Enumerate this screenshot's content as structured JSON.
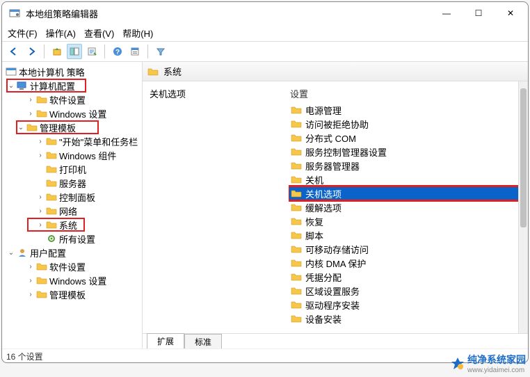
{
  "window": {
    "title": "本地组策略编辑器",
    "controls": {
      "min": "—",
      "max": "☐",
      "close": "✕"
    }
  },
  "menu": {
    "file": "文件(F)",
    "action": "操作(A)",
    "view": "查看(V)",
    "help": "帮助(H)"
  },
  "toolbar_icons": [
    "back",
    "forward",
    "up",
    "list",
    "export",
    "refresh",
    "help",
    "properties",
    "filter"
  ],
  "tree": {
    "root": "本地计算机 策略",
    "computer_config": "计算机配置",
    "software": "软件设置",
    "windows_settings": "Windows 设置",
    "admin_templates": "管理模板",
    "start_menu": "\"开始\"菜单和任务栏",
    "win_components": "Windows 组件",
    "printers": "打印机",
    "servers": "服务器",
    "control_panel": "控制面板",
    "network": "网络",
    "system": "系统",
    "all_settings": "所有设置",
    "user_config": "用户配置",
    "u_software": "软件设置",
    "u_windows": "Windows 设置",
    "u_admin": "管理模板"
  },
  "content": {
    "header_label": "系统",
    "left_title": "关机选项",
    "col_header": "设置",
    "items": [
      "电源管理",
      "访问被拒绝协助",
      "分布式 COM",
      "服务控制管理器设置",
      "服务器管理器",
      "关机",
      "关机选项",
      "缓解选项",
      "恢复",
      "脚本",
      "可移动存储访问",
      "内核 DMA 保护",
      "凭据分配",
      "区域设置服务",
      "驱动程序安装",
      "设备安装"
    ],
    "selected_index": 6
  },
  "tabs": {
    "extended": "扩展",
    "standard": "标准"
  },
  "statusbar": "16 个设置",
  "watermark": {
    "brand": "纯净系统家园",
    "url": "www.yidaimei.com"
  }
}
